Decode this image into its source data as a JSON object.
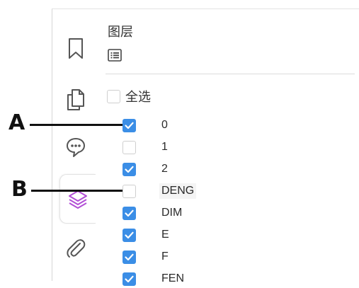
{
  "panel": {
    "title": "图层",
    "select_all_label": "全选"
  },
  "layers": [
    {
      "name": "0",
      "checked": true
    },
    {
      "name": "1",
      "checked": false
    },
    {
      "name": "2",
      "checked": true
    },
    {
      "name": "DENG",
      "checked": false
    },
    {
      "name": "DIM",
      "checked": true
    },
    {
      "name": "E",
      "checked": true
    },
    {
      "name": "F",
      "checked": true
    },
    {
      "name": "FEN",
      "checked": true
    }
  ],
  "callouts": {
    "a": "A",
    "b": "B"
  },
  "icons": {
    "rail": [
      "bookmark-icon",
      "pages-icon",
      "comment-icon",
      "layers-icon",
      "attachment-icon"
    ],
    "panel_menu": "options-menu-icon"
  },
  "colors": {
    "accent": "#3b8ee6",
    "layers_active": "#b24fd6",
    "rail_icon": "#555555"
  }
}
